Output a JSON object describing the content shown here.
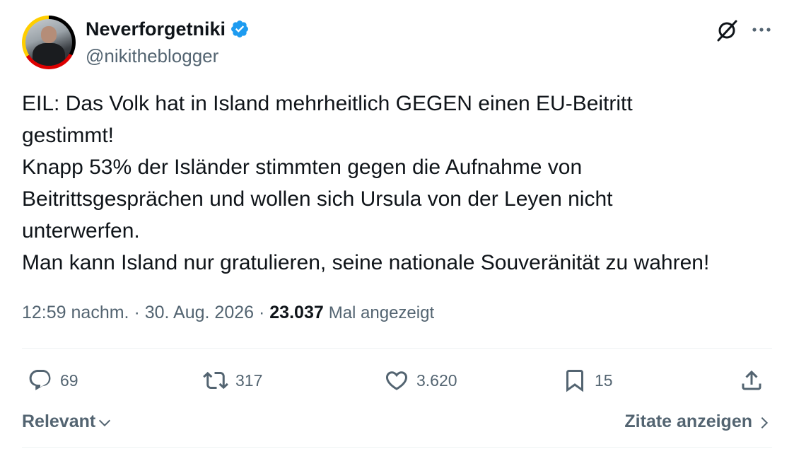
{
  "author": {
    "display_name": "Neverforgetniki",
    "handle": "@nikitheblogger",
    "verified": true
  },
  "header_icons": [
    "grok-icon",
    "more-icon"
  ],
  "body_lines": [
    "EIL: Das Volk hat in Island mehrheitlich GEGEN einen EU-Beitritt",
    "gestimmt!",
    "Knapp 53% der Isländer stimmten gegen die Aufnahme von",
    "Beitrittsgesprächen und wollen sich Ursula von der Leyen nicht",
    "unterwerfen.",
    "Man kann Island nur gratulieren, seine nationale Souveränität zu wahren!"
  ],
  "meta": {
    "time": "12:59 nachm.",
    "separator": "·",
    "date": "30. Aug. 2026",
    "views_count": "23.037",
    "views_label": "Mal angezeigt"
  },
  "actions": {
    "replies": "69",
    "reposts": "317",
    "likes": "3.620",
    "bookmarks": "15"
  },
  "footer": {
    "sort_label": "Relevant",
    "quotes_label": "Zitate anzeigen"
  },
  "colors": {
    "text": "#0f1419",
    "secondary": "#536471",
    "verified": "#1d9bf0",
    "divider": "#eff3f4"
  }
}
